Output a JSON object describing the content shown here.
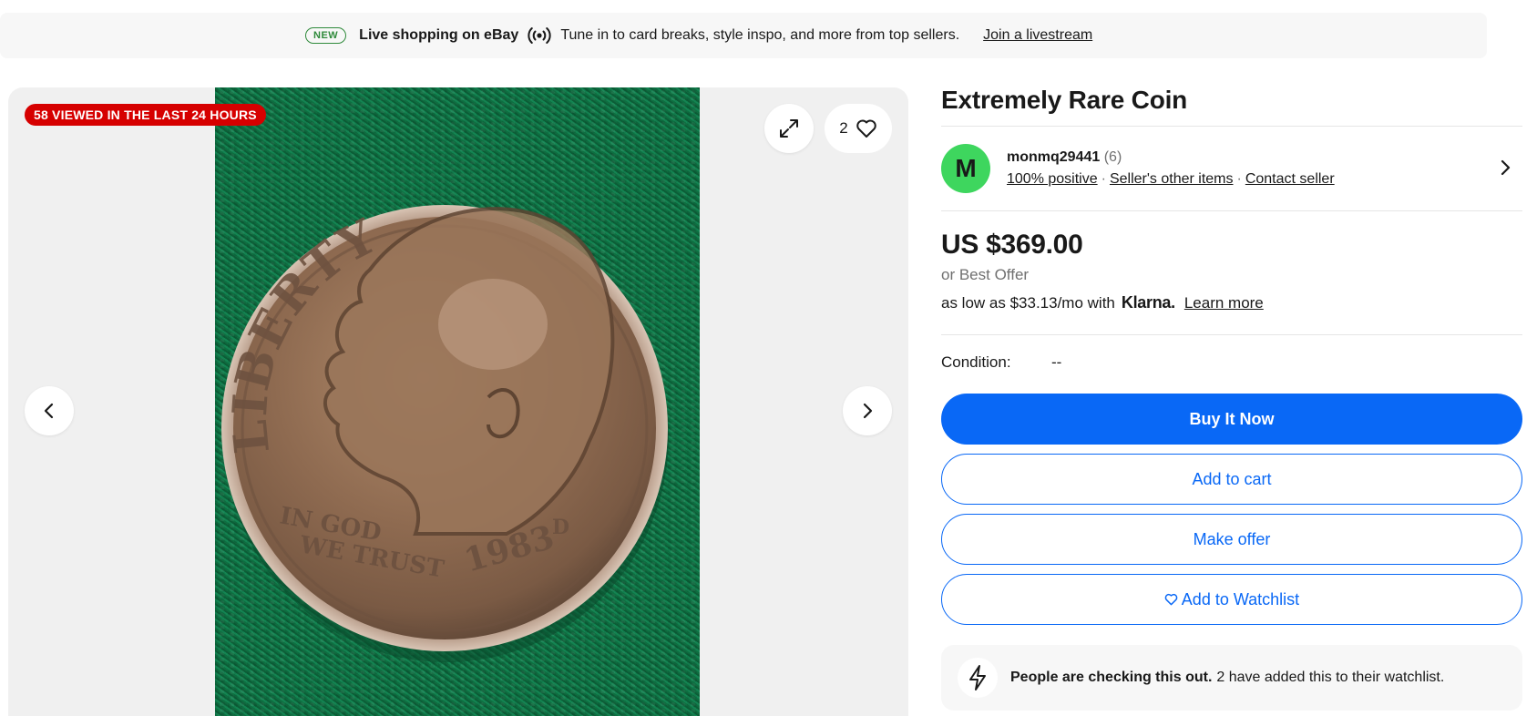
{
  "banner": {
    "badge": "NEW",
    "title": "Live shopping on eBay",
    "icon": "live-broadcast-icon",
    "text": "Tune in to card breaks, style inspo, and more from top sellers.",
    "link": "Join a livestream"
  },
  "gallery": {
    "viewed_badge": "58 VIEWED IN THE LAST 24 HOURS",
    "watch_count": "2",
    "coin_inscriptions": {
      "top": "LIBERTY",
      "motto_line1": "IN GOD",
      "motto_line2": "WE TRUST",
      "year": "1983",
      "mint_mark": "D"
    }
  },
  "item": {
    "title": "Extremely Rare Coin"
  },
  "seller": {
    "avatar_letter": "M",
    "name": "monmq29441",
    "count": "(6)",
    "positive": "100% positive",
    "other_items": "Seller's other items",
    "contact": "Contact seller"
  },
  "pricing": {
    "price": "US $369.00",
    "best_offer": "or Best Offer",
    "klarna_prefix": "as low as $33.13/mo with",
    "klarna_brand": "Klarna.",
    "learn_more": "Learn more"
  },
  "condition": {
    "label": "Condition:",
    "value": "--"
  },
  "buttons": {
    "buy_now": "Buy It Now",
    "add_to_cart": "Add to cart",
    "make_offer": "Make offer",
    "add_to_watchlist": "Add to Watchlist"
  },
  "insight": {
    "bold": "People are checking this out.",
    "text": "2 have added this to their watchlist."
  },
  "colors": {
    "primary_blue": "#0968f6",
    "badge_red": "#d60000",
    "avatar_green": "#3ed65e",
    "new_badge_green": "#2f8a3b"
  }
}
